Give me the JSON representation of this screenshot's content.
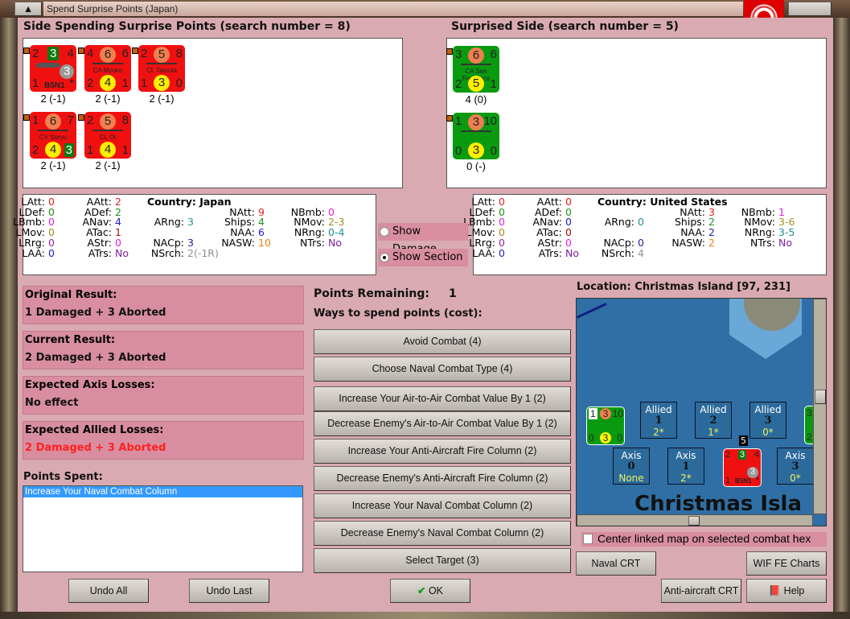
{
  "window": {
    "title": "Spend Surprise Points (Japan)"
  },
  "left_panel": {
    "title": "Side Spending Surprise Points (search number = 8)",
    "counters": [
      {
        "color": "#f01010",
        "tl": "2",
        "tc": "3",
        "tc_box": "green",
        "tr": "4",
        "name": "B5N1",
        "bl": "1",
        "bc": "3",
        "bc_style": "gray",
        "br": "*",
        "caption": "2 (-1)",
        "type": "plane"
      },
      {
        "color": "#f01010",
        "tl": "4",
        "tc": "6",
        "tr": "6",
        "name": "CA Myoko",
        "bl": "2",
        "bc": "4",
        "br": "1",
        "caption": "2 (-1)",
        "type": "ship"
      },
      {
        "color": "#f01010",
        "tl": "2",
        "tc": "5",
        "tr": "8",
        "name": "CL Tatsuta",
        "bl": "1",
        "bc": "3",
        "br": "0",
        "caption": "2 (-1)",
        "type": "ship"
      },
      {
        "color": "#f01010",
        "tl": "1",
        "tc": "6",
        "tr": "7",
        "name": "CV Soryu",
        "bl": "2",
        "bc": "4",
        "br": "3",
        "caption": "2 (-1)",
        "type": "ship"
      },
      {
        "color": "#f01010",
        "tl": "2",
        "tc": "5",
        "tr": "8",
        "name": "CL Oi",
        "bl": "1",
        "bc": "4",
        "br": "1",
        "caption": "2 (-1)",
        "type": "ship"
      }
    ]
  },
  "right_panel": {
    "title": "Surprised Side (search number = 5)",
    "counters": [
      {
        "color": "#0a9a10",
        "tl": "3",
        "tc": "6",
        "tr": "6",
        "name": "CA San Francisco",
        "bl": "2",
        "bc": "5",
        "br": "1",
        "caption": "4 (0)",
        "type": "ship"
      },
      {
        "color": "#0a9a10",
        "tl": "1",
        "tc": "3",
        "tr": "10",
        "name": "",
        "bl": "0",
        "bc": "3",
        "br": "0",
        "caption": "0 (-)",
        "type": "ship"
      }
    ]
  },
  "stats_japan": {
    "country_label": "Country: Japan",
    "items": [
      {
        "k": "LAtt:",
        "v": "0",
        "c": "#e02020"
      },
      {
        "k": "LDef:",
        "v": "0",
        "c": "#209020"
      },
      {
        "k": "LBmb:",
        "v": "0",
        "c": "#e020e0"
      },
      {
        "k": "LMov:",
        "v": "0",
        "c": "#a09020"
      },
      {
        "k": "LRrg:",
        "v": "0",
        "c": "#a020a0"
      },
      {
        "k": "LAA:",
        "v": "0",
        "c": "#2020c0"
      },
      {
        "k": "AAtt:",
        "v": "2",
        "c": "#e02020"
      },
      {
        "k": "ADef:",
        "v": "2",
        "c": "#209020"
      },
      {
        "k": "ANav:",
        "v": "4",
        "c": "#2020c0"
      },
      {
        "k": "ATac:",
        "v": "1",
        "c": "#a01010"
      },
      {
        "k": "AStr:",
        "v": "0",
        "c": "#e020e0"
      },
      {
        "k": "ATrs:",
        "v": "No",
        "c": "#8020a0"
      },
      {
        "k": "ARng:",
        "v": "3",
        "c": "#209090"
      },
      {
        "k": "NACp:",
        "v": "3",
        "c": "#2020a0"
      },
      {
        "k": "NSrch:",
        "v": "2(-1R)",
        "c": "#909090"
      },
      {
        "k": "NAtt:",
        "v": "9",
        "c": "#e02020"
      },
      {
        "k": "Ships:",
        "v": "4",
        "c": "#209020"
      },
      {
        "k": "NAA:",
        "v": "6",
        "c": "#2020c0"
      },
      {
        "k": "NASW:",
        "v": "10",
        "c": "#f08020"
      },
      {
        "k": "NBmb:",
        "v": "0",
        "c": "#e020e0"
      },
      {
        "k": "NMov:",
        "v": "2-3",
        "c": "#a09020"
      },
      {
        "k": "NRng:",
        "v": "0-4",
        "c": "#209090"
      },
      {
        "k": "NTrs:",
        "v": "No",
        "c": "#8020a0"
      }
    ]
  },
  "stats_us": {
    "country_label": "Country: United States",
    "items": [
      {
        "k": "LAtt:",
        "v": "0",
        "c": "#e02020"
      },
      {
        "k": "LDef:",
        "v": "0",
        "c": "#209020"
      },
      {
        "k": "LBmb:",
        "v": "0",
        "c": "#e020e0"
      },
      {
        "k": "LMov:",
        "v": "0",
        "c": "#a09020"
      },
      {
        "k": "LRrg:",
        "v": "0",
        "c": "#a020a0"
      },
      {
        "k": "LAA:",
        "v": "0",
        "c": "#2020c0"
      },
      {
        "k": "AAtt:",
        "v": "0",
        "c": "#e02020"
      },
      {
        "k": "ADef:",
        "v": "0",
        "c": "#209020"
      },
      {
        "k": "ANav:",
        "v": "0",
        "c": "#2020c0"
      },
      {
        "k": "ATac:",
        "v": "0",
        "c": "#a01010"
      },
      {
        "k": "AStr:",
        "v": "0",
        "c": "#e020e0"
      },
      {
        "k": "ATrs:",
        "v": "No",
        "c": "#8020a0"
      },
      {
        "k": "ARng:",
        "v": "0",
        "c": "#209090"
      },
      {
        "k": "NACp:",
        "v": "0",
        "c": "#2020a0"
      },
      {
        "k": "NSrch:",
        "v": "4",
        "c": "#909090"
      },
      {
        "k": "NAtt:",
        "v": "3",
        "c": "#e02020"
      },
      {
        "k": "Ships:",
        "v": "2",
        "c": "#209020"
      },
      {
        "k": "NAA:",
        "v": "2",
        "c": "#2020c0"
      },
      {
        "k": "NASW:",
        "v": "2",
        "c": "#f08020"
      },
      {
        "k": "NBmb:",
        "v": "1",
        "c": "#e020e0"
      },
      {
        "k": "NMov:",
        "v": "3-6",
        "c": "#a09020"
      },
      {
        "k": "NRng:",
        "v": "3-5",
        "c": "#209090"
      },
      {
        "k": "NTrs:",
        "v": "No",
        "c": "#8020a0"
      }
    ]
  },
  "options": {
    "show_damage": "Show Damage",
    "show_section": "Show Section",
    "selected": "show_section"
  },
  "results": [
    {
      "title": "Original Result:",
      "value": "1 Damaged + 3 Aborted",
      "color": "#111111"
    },
    {
      "title": "Current Result:",
      "value": "2 Damaged + 3 Aborted",
      "color": "#111111"
    },
    {
      "title": "Expected Axis Losses:",
      "value": "No effect",
      "color": "#111111"
    },
    {
      "title": "Expected Allied Losses:",
      "value": "2 Damaged + 3 Aborted",
      "color": "#ff2020"
    }
  ],
  "points_spent": {
    "label": "Points Spent:",
    "items": [
      "Increase Your Naval Combat Column"
    ]
  },
  "points_remaining": {
    "label": "Points Remaining:",
    "value": "1"
  },
  "ways_label": "Ways to spend points (cost):",
  "actions": [
    "Avoid Combat (4)",
    "Choose Naval Combat Type (4)",
    "Increase Your Air-to-Air Combat Value By 1 (2)",
    "Decrease Enemy's Air-to-Air Combat Value By 1 (2)",
    "Increase Your Anti-Aircraft Fire Column (2)",
    "Decrease Enemy's Anti-Aircraft Fire Column (2)",
    "Increase Your Naval Combat Column (2)",
    "Decrease Enemy's Naval Combat Column (2)",
    "Select Target (3)"
  ],
  "map": {
    "location": "Location: Christmas Island [97, 231]",
    "place_name": "Christmas Isla",
    "allied": [
      {
        "side": "Allied",
        "n": "1",
        "v": "2*"
      },
      {
        "side": "Allied",
        "n": "2",
        "v": "1*"
      },
      {
        "side": "Allied",
        "n": "3",
        "v": "0*"
      }
    ],
    "axis": [
      {
        "side": "Axis",
        "n": "0",
        "v": "None"
      },
      {
        "side": "Axis",
        "n": "1",
        "v": "2*"
      },
      {
        "side": "Axis",
        "n": "3",
        "v": "0*"
      }
    ],
    "stack_count": "5",
    "us_counter": {
      "tl": "1",
      "tc": "3",
      "tr": "10",
      "bl": "0",
      "bc": "3",
      "br": "0"
    },
    "jp_counter": {
      "tl": "2",
      "tc": "3",
      "tr": "4",
      "bl": "1",
      "bc": "3",
      "name": "B5N1",
      "br": "*"
    },
    "edge_counter": {
      "t": "3",
      "b": "2"
    }
  },
  "center_checkbox": {
    "label": "Center linked map on selected combat hex",
    "checked": false
  },
  "buttons": {
    "naval_crt": "Naval CRT",
    "wif_charts": "WIF FE Charts",
    "aa_crt": "Anti-aircraft CRT",
    "help": "Help",
    "undo_all": "Undo All",
    "undo_last": "Undo Last",
    "ok": "OK"
  }
}
